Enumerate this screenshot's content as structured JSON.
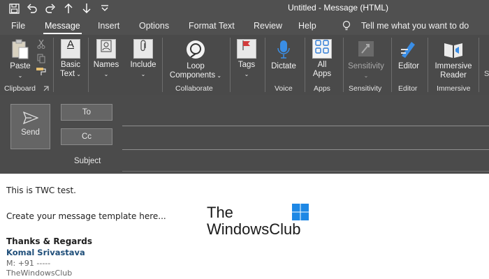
{
  "titlebar": {
    "title": "Untitled  -  Message (HTML)",
    "qat_icons": [
      "save-icon",
      "undo-icon",
      "redo-icon",
      "up-arrow-icon",
      "down-arrow-icon",
      "customize-icon"
    ]
  },
  "menu": {
    "tabs": [
      "File",
      "Message",
      "Insert",
      "Options",
      "Format Text",
      "Review",
      "Help"
    ],
    "active_tab": "Message",
    "tell_me": "Tell me what you want to do"
  },
  "ribbon": {
    "paste": "Paste",
    "basic_text_1": "Basic",
    "basic_text_2": "Text",
    "names": "Names",
    "include": "Include",
    "loop_1": "Loop",
    "loop_2": "Components",
    "tags": "Tags",
    "dictate": "Dictate",
    "all_apps_1": "All",
    "all_apps_2": "Apps",
    "sensitivity": "Sensitivity",
    "editor": "Editor",
    "immersive_1": "Immersive",
    "immersive_2": "Reader",
    "groups": {
      "clipboard": "Clipboard",
      "collaborate": "Collaborate",
      "voice": "Voice",
      "apps": "Apps",
      "sensitivity": "Sensitivity",
      "editor": "Editor",
      "immersive": "Immersive"
    }
  },
  "compose": {
    "send": "Send",
    "to": "To",
    "cc": "Cc",
    "subject": "Subject"
  },
  "message_body": {
    "line1": "This is TWC test.",
    "line2": "Create your message template here...",
    "regards": "Thanks & Regards",
    "name": "Komal Srivastava",
    "phone": "M: +91 -----",
    "company": "TheWindowsClub",
    "logo_line1": "The",
    "logo_line2": "WindowsClub"
  },
  "colors": {
    "ribbon_bg": "#4a4a4a",
    "titlebar_bg": "#505050",
    "name_blue": "#1f4e79",
    "windows_logo": "#1e88e5"
  }
}
